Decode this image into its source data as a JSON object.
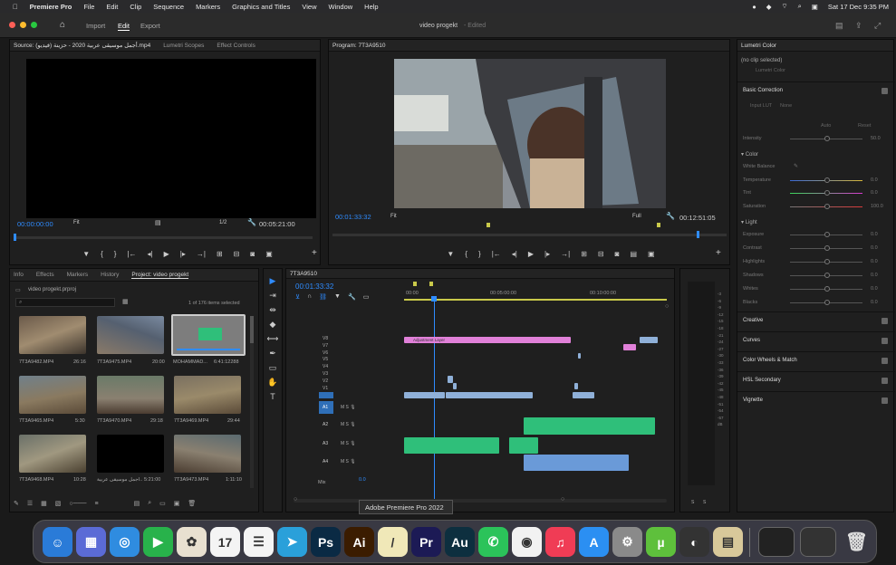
{
  "menubar": {
    "app": "Premiere Pro",
    "items": [
      "File",
      "Edit",
      "Clip",
      "Sequence",
      "Markers",
      "Graphics and Titles",
      "View",
      "Window",
      "Help"
    ],
    "datetime": "Sat 17 Dec  9:35 PM"
  },
  "titlebar": {
    "nav": [
      "Import",
      "Edit",
      "Export"
    ],
    "doc_title": "video progekt",
    "doc_status": "- Edited"
  },
  "source": {
    "tabs": [
      "Source: (فيديو) أجمل موسيقى عربية 2020 - حزينة.mp4",
      "Lumetri Scopes",
      "Effect Controls"
    ],
    "timecode_in": "00:00:00:00",
    "fit": "Fit",
    "ratio": "1/2",
    "duration": "00:05:21:00"
  },
  "program": {
    "tab": "Program: 7T3A9510",
    "timecode": "00:01:33:32",
    "fit": "Fit",
    "quality": "Full",
    "duration": "00:12:51:05"
  },
  "project": {
    "tabs": [
      "Info",
      "Effects",
      "Markers",
      "History",
      "Project: video progekt"
    ],
    "file": "video progekt.prproj",
    "count": "1 of 176 items selected",
    "items": [
      {
        "name": "7T3A9482.MP4",
        "dur": "26:16"
      },
      {
        "name": "7T3A9475.MP4",
        "dur": "20:00"
      },
      {
        "name": "MOHAMMAD...",
        "dur": "6:41:12288"
      },
      {
        "name": "7T3A9465.MP4",
        "dur": "5:30"
      },
      {
        "name": "7T3A9470.MP4",
        "dur": "29:18"
      },
      {
        "name": "7T3A9469.MP4",
        "dur": "29:44"
      },
      {
        "name": "7T3A9468.MP4",
        "dur": "10:28"
      },
      {
        "name": "أجمل موسيقى عربية...",
        "dur": "5:21:00"
      },
      {
        "name": "7T3A9473.MP4",
        "dur": "1:11:10"
      }
    ]
  },
  "timeline": {
    "tab": "7T3A9510",
    "timecode": "00:01:33:32",
    "ruler": [
      "00:00",
      "00:05:00:00",
      "00:10:00:00"
    ],
    "video_tracks": [
      "V8",
      "V7",
      "V6",
      "V5",
      "V4",
      "V3",
      "V2",
      "V1"
    ],
    "audio_tracks": [
      "A1",
      "A2",
      "A3",
      "A4"
    ],
    "mix": "Mix",
    "mix_val": "0.0",
    "adjustment_label": "Adjustment Layer",
    "meter_ticks": [
      "-3",
      "-6",
      "-9",
      "-12",
      "-15",
      "-18",
      "-21",
      "-24",
      "-27",
      "-30",
      "-33",
      "-36",
      "-39",
      "-42",
      "-45",
      "-48",
      "-51",
      "-54",
      "-57",
      "dB"
    ],
    "meter_footer": [
      "S",
      "S"
    ],
    "tooltip": "Adobe Premiere Pro 2022"
  },
  "lumetri": {
    "title": "Lumetri Color",
    "no_clip": "(no clip selected)",
    "clip_field": "Lumetri Color",
    "basic": "Basic Correction",
    "input_lut_label": "Input LUT",
    "input_lut_val": "None",
    "auto": "Auto",
    "reset": "Reset",
    "intensity": {
      "label": "Intensity",
      "val": "50.0"
    },
    "color_section": "Color",
    "color_rows": [
      {
        "label": "White Balance",
        "val": ""
      },
      {
        "label": "Temperature",
        "val": "0.0"
      },
      {
        "label": "Tint",
        "val": "0.0"
      },
      {
        "label": "Saturation",
        "val": "100.0"
      }
    ],
    "light_section": "Light",
    "light_rows": [
      {
        "label": "Exposure",
        "val": "0.0"
      },
      {
        "label": "Contrast",
        "val": "0.0"
      },
      {
        "label": "Highlights",
        "val": "0.0"
      },
      {
        "label": "Shadows",
        "val": "0.0"
      },
      {
        "label": "Whites",
        "val": "0.0"
      },
      {
        "label": "Blacks",
        "val": "0.0"
      }
    ],
    "sections": [
      "Creative",
      "Curves",
      "Color Wheels & Match",
      "HSL Secondary",
      "Vignette"
    ]
  },
  "dock": {
    "apps": [
      {
        "name": "Finder",
        "color": "#2a7bd8",
        "glyph": "☺"
      },
      {
        "name": "Launchpad",
        "color": "#5b6bd6",
        "glyph": "▦"
      },
      {
        "name": "Safari",
        "color": "#2f8ce0",
        "glyph": "◎"
      },
      {
        "name": "FaceTime",
        "color": "#28b24b",
        "glyph": "▶"
      },
      {
        "name": "Photos",
        "color": "#e8e0d0",
        "glyph": "✿"
      },
      {
        "name": "Calendar",
        "color": "#f4f4f4",
        "glyph": "17"
      },
      {
        "name": "Reminders",
        "color": "#f4f4f4",
        "glyph": "☰"
      },
      {
        "name": "Telegram",
        "color": "#2aa0da",
        "glyph": "➤"
      },
      {
        "name": "Photoshop",
        "color": "#0a2a44",
        "glyph": "Ps"
      },
      {
        "name": "Illustrator",
        "color": "#3b1c00",
        "glyph": "Ai"
      },
      {
        "name": "Notes",
        "color": "#f0e8b8",
        "glyph": "/"
      },
      {
        "name": "Premiere",
        "color": "#1c1a55",
        "glyph": "Pr"
      },
      {
        "name": "Audition",
        "color": "#0d2f3f",
        "glyph": "Au"
      },
      {
        "name": "WhatsApp",
        "color": "#2bc35a",
        "glyph": "✆"
      },
      {
        "name": "Chrome",
        "color": "#f2f2f2",
        "glyph": "◉"
      },
      {
        "name": "Music",
        "color": "#f03c55",
        "glyph": "♫"
      },
      {
        "name": "App Store",
        "color": "#2b8ff2",
        "glyph": "A"
      },
      {
        "name": "Settings",
        "color": "#8a8a8a",
        "glyph": "⚙"
      },
      {
        "name": "uTorrent",
        "color": "#5ec03c",
        "glyph": "µ"
      },
      {
        "name": "DaVinci",
        "color": "#333",
        "glyph": "◐"
      },
      {
        "name": "Preview",
        "color": "#d8c89a",
        "glyph": "▤"
      }
    ],
    "calendar_month": "DEC"
  }
}
